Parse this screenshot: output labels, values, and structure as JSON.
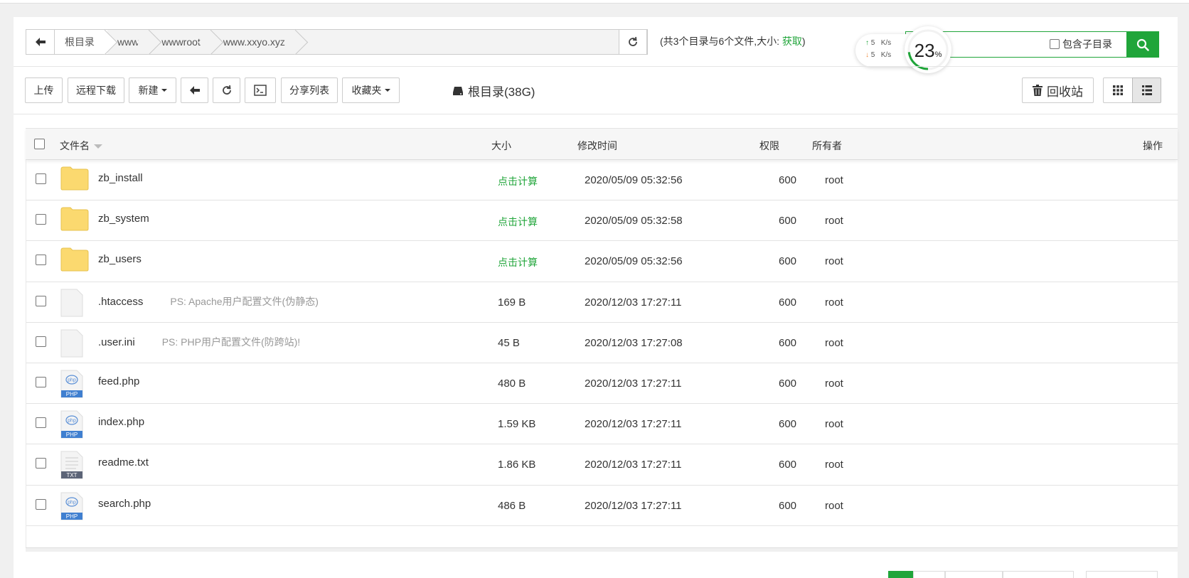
{
  "breadcrumb": {
    "items": [
      "根目录",
      "www",
      "wwwroot",
      "www.xxyo.xyz"
    ]
  },
  "summary": {
    "text": "(共3个目录与6个文件,大小: ",
    "link": "获取",
    "close": ")"
  },
  "speed": {
    "up_value": "5",
    "up_unit": "K/s",
    "down_value": "5",
    "down_unit": "K/s"
  },
  "gauge": {
    "value": "23",
    "unit": "%",
    "percent": 23
  },
  "search": {
    "value": "",
    "subdir_label": "包含子目录"
  },
  "toolbar": {
    "upload": "上传",
    "remote_download": "远程下载",
    "new": "新建",
    "share_list": "分享列表",
    "favorites": "收藏夹",
    "disk": "根目录(38G)",
    "recycle": "回收站"
  },
  "table": {
    "headers": {
      "name": "文件名",
      "size": "大小",
      "mtime": "修改时间",
      "perm": "权限",
      "owner": "所有者",
      "actions": "操作"
    },
    "rows": [
      {
        "name": "zb_install",
        "ps": "",
        "size": "点击计算",
        "mtime": "2020/05/09 05:32:56",
        "perm": "600",
        "owner": "root",
        "type": "folder"
      },
      {
        "name": "zb_system",
        "ps": "",
        "size": "点击计算",
        "mtime": "2020/05/09 05:32:58",
        "perm": "600",
        "owner": "root",
        "type": "folder"
      },
      {
        "name": "zb_users",
        "ps": "",
        "size": "点击计算",
        "mtime": "2020/05/09 05:32:56",
        "perm": "600",
        "owner": "root",
        "type": "folder"
      },
      {
        "name": ".htaccess",
        "ps": "PS: Apache用户配置文件(伪静态)",
        "size": "169 B",
        "mtime": "2020/12/03 17:27:11",
        "perm": "600",
        "owner": "root",
        "type": "blank"
      },
      {
        "name": ".user.ini",
        "ps": "PS: PHP用户配置文件(防跨站)!",
        "size": "45 B",
        "mtime": "2020/12/03 17:27:08",
        "perm": "600",
        "owner": "root",
        "type": "blank"
      },
      {
        "name": "feed.php",
        "ps": "",
        "size": "480 B",
        "mtime": "2020/12/03 17:27:11",
        "perm": "600",
        "owner": "root",
        "type": "php"
      },
      {
        "name": "index.php",
        "ps": "",
        "size": "1.59 KB",
        "mtime": "2020/12/03 17:27:11",
        "perm": "600",
        "owner": "root",
        "type": "php"
      },
      {
        "name": "readme.txt",
        "ps": "",
        "size": "1.86 KB",
        "mtime": "2020/12/03 17:27:11",
        "perm": "600",
        "owner": "root",
        "type": "txt"
      },
      {
        "name": "search.php",
        "ps": "",
        "size": "486 B",
        "mtime": "2020/12/03 17:27:11",
        "perm": "600",
        "owner": "root",
        "type": "php"
      }
    ]
  },
  "icons": {
    "php_label": "PHP",
    "php_badge": "php",
    "txt_label": "TXT"
  },
  "colors": {
    "accent": "#20a53a",
    "folder": "#fbd96f",
    "upload_arrow": "#20a53a",
    "download_arrow": "#f0883a"
  }
}
